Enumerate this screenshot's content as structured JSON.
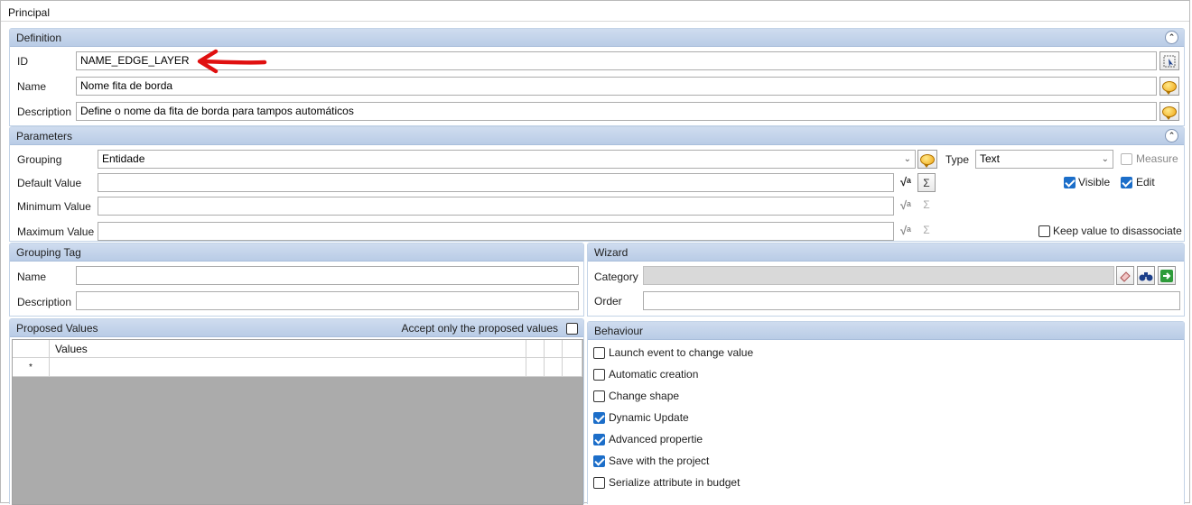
{
  "tab": {
    "title": "Principal"
  },
  "definition": {
    "title": "Definition",
    "id_label": "ID",
    "id_value": "NAME_EDGE_LAYER",
    "name_label": "Name",
    "name_value": "Nome fita de borda",
    "description_label": "Description",
    "description_value": "Define o nome da fita de borda para tampos automáticos"
  },
  "parameters": {
    "title": "Parameters",
    "grouping_label": "Grouping",
    "grouping_value": "Entidade",
    "type_label": "Type",
    "type_value": "Text",
    "measure_label": "Measure",
    "default_value_label": "Default Value",
    "minimum_value_label": "Minimum Value",
    "maximum_value_label": "Maximum Value",
    "visible_label": "Visible",
    "edit_label": "Edit",
    "keep_value_label": "Keep value to disassociate",
    "checks": {
      "measure": false,
      "visible": true,
      "edit": true,
      "keep_value": false
    }
  },
  "grouping_tag": {
    "title": "Grouping Tag",
    "name_label": "Name",
    "description_label": "Description"
  },
  "wizard": {
    "title": "Wizard",
    "category_label": "Category",
    "order_label": "Order"
  },
  "proposed_values": {
    "title": "Proposed Values",
    "accept_only_label": "Accept only the proposed values",
    "accept_only_checked": false,
    "column_header": "Values",
    "new_row_marker": "*"
  },
  "behaviour": {
    "title": "Behaviour",
    "options": [
      {
        "label": "Launch event to change value",
        "checked": false
      },
      {
        "label": "Automatic creation",
        "checked": false
      },
      {
        "label": "Change shape",
        "checked": false
      },
      {
        "label": "Dynamic Update",
        "checked": true
      },
      {
        "label": "Advanced propertie",
        "checked": true
      },
      {
        "label": "Save with the project",
        "checked": true
      },
      {
        "label": "Serialize attribute in budget",
        "checked": false
      }
    ]
  },
  "colors": {
    "header_blue": "#b9cce6",
    "check_blue": "#1c6ec9",
    "annotation_red": "#e01010"
  }
}
